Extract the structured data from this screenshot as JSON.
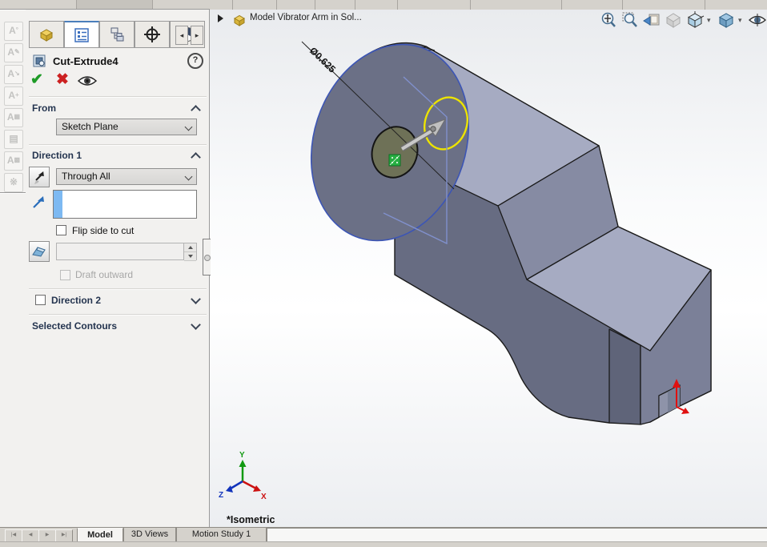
{
  "colors": {
    "accent_blue": "#4a7ebb",
    "selection_strip": "#7db9f2",
    "part_light": "#a6abc2",
    "part_medium": "#868ba3",
    "part_medium_dark": "#7b8098",
    "part_dark": "#676c82",
    "part_darker": "#5f6479",
    "lobe_face": "#6b7086",
    "hole_face": "#6e7157",
    "notch_face": "#8e93a9",
    "edge": "#1a1a1a",
    "sketch_blue": "#3c55b5",
    "plane_blue": "#8090cc",
    "preview_yellow": "#ede400",
    "handle_green": "#27ae42",
    "arrow_red": "#e01010",
    "triad_x": "#cc1111",
    "triad_y": "#119911",
    "triad_z": "#1133bb",
    "check_green": "#1f9b27",
    "cancel_red": "#cc2121"
  },
  "property_manager": {
    "title": "Cut-Extrude4",
    "help_label": "?",
    "tabs": [
      "feature-manager",
      "property-manager",
      "configuration-manager",
      "dimxpert-manager",
      "display-manager"
    ],
    "from": {
      "label": "From",
      "value": "Sketch Plane"
    },
    "direction1": {
      "label": "Direction 1",
      "value": "Through All",
      "selection_value": "",
      "flip_label": "Flip side to cut",
      "draft_value": "",
      "draft_outward_label": "Draft outward"
    },
    "direction2": {
      "label": "Direction 2"
    },
    "contours": {
      "label": "Selected Contours"
    }
  },
  "feature_tree": {
    "title": "Model Vibrator Arm in Sol..."
  },
  "viewport": {
    "dimension_label": "Ø0.625",
    "view_label": "*Isometric",
    "triad": {
      "x": "X",
      "y": "Y",
      "z": "Z"
    }
  },
  "headsup": {
    "icons": [
      "zoom-to-fit",
      "zoom-to-area",
      "previous-view",
      "section-view",
      "view-orientation",
      "display-style",
      "hide-show-items"
    ]
  },
  "bottom_bar": {
    "tabs": [
      {
        "label": "Model",
        "active": true
      },
      {
        "label": "3D Views",
        "active": false
      },
      {
        "label": "Motion Study 1",
        "active": false
      }
    ]
  }
}
